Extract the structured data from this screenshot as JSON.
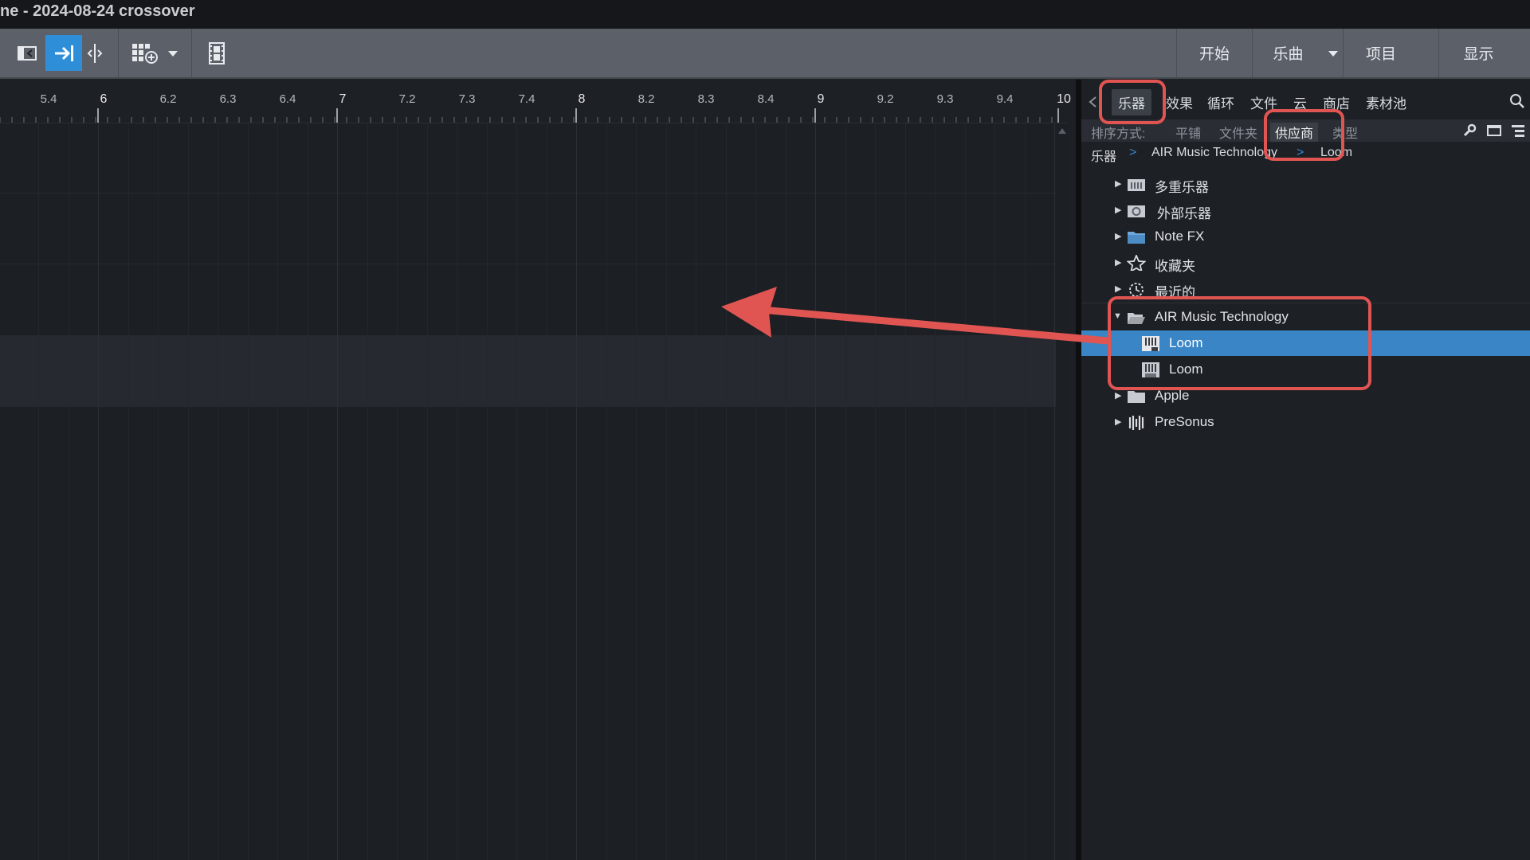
{
  "window": {
    "title": "ne - 2024-08-24 crossover"
  },
  "toolbar": {
    "right_buttons": [
      "开始",
      "乐曲",
      "项目",
      "显示"
    ]
  },
  "ruler": {
    "labels": [
      "5.4",
      "6",
      "6.2",
      "6.3",
      "6.4",
      "7",
      "7.2",
      "7.3",
      "7.4",
      "8",
      "8.2",
      "8.3",
      "8.4",
      "9",
      "9.2",
      "9.3",
      "9.4",
      "10"
    ]
  },
  "browser": {
    "tabs": [
      "乐器",
      "效果",
      "循环",
      "文件",
      "云",
      "商店",
      "素材池"
    ],
    "active_tab": "乐器",
    "sort": {
      "label": "排序方式:",
      "options": [
        "平铺",
        "文件夹",
        "供应商",
        "类型"
      ],
      "selected": "供应商"
    },
    "breadcrumb": [
      "乐器",
      "AIR Music Technology",
      "Loom"
    ],
    "tree": [
      {
        "label": "多重乐器",
        "icon": "multi-instrument-folder-icon"
      },
      {
        "label": "外部乐器",
        "icon": "external-instrument-folder-icon"
      },
      {
        "label": "Note FX",
        "icon": "note-fx-folder-icon"
      },
      {
        "label": "收藏夹",
        "icon": "star-icon"
      },
      {
        "label": "最近的",
        "icon": "clock-icon"
      },
      {
        "label": "AIR Music Technology",
        "icon": "open-folder-icon"
      },
      {
        "label": "Loom",
        "icon": "plugin-keyboard-icon"
      },
      {
        "label": "Loom",
        "icon": "plugin-au-keyboard-icon"
      },
      {
        "label": "Apple",
        "icon": "folder-icon"
      },
      {
        "label": "PreSonus",
        "icon": "presonus-icon"
      }
    ]
  },
  "colors": {
    "accent": "#2f8ed8",
    "selection": "#3a85c6",
    "callout": "#e05552"
  }
}
